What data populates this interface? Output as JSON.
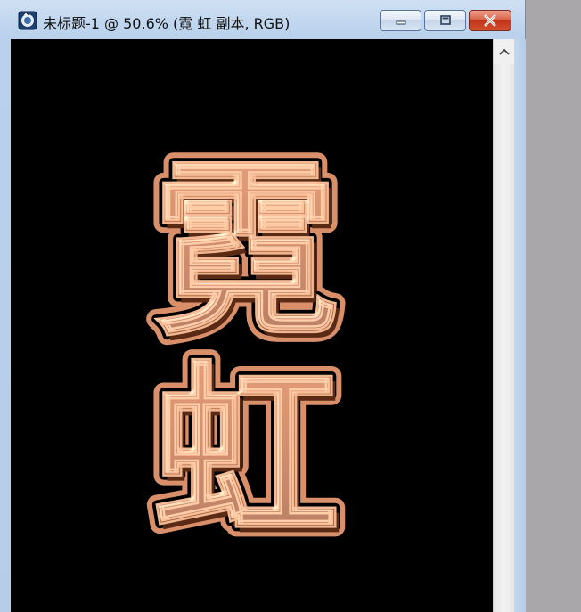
{
  "window": {
    "title": "未标题-1 @ 50.6% (霓 虹 副本, RGB)",
    "icons": {
      "app": "photoshop-document-icon",
      "minimize": "minimize-icon",
      "maximize": "maximize-icon",
      "close": "close-icon",
      "scroll_up": "chevron-up-icon"
    }
  },
  "canvas": {
    "background_color": "#000000",
    "text_layer": {
      "characters": [
        "霓",
        "虹"
      ],
      "fill_color": "#b86a42",
      "outline_color": "#d68a5c",
      "highlight_color": "#f2c2a2",
      "shadow_color": "#5a2a14"
    }
  }
}
